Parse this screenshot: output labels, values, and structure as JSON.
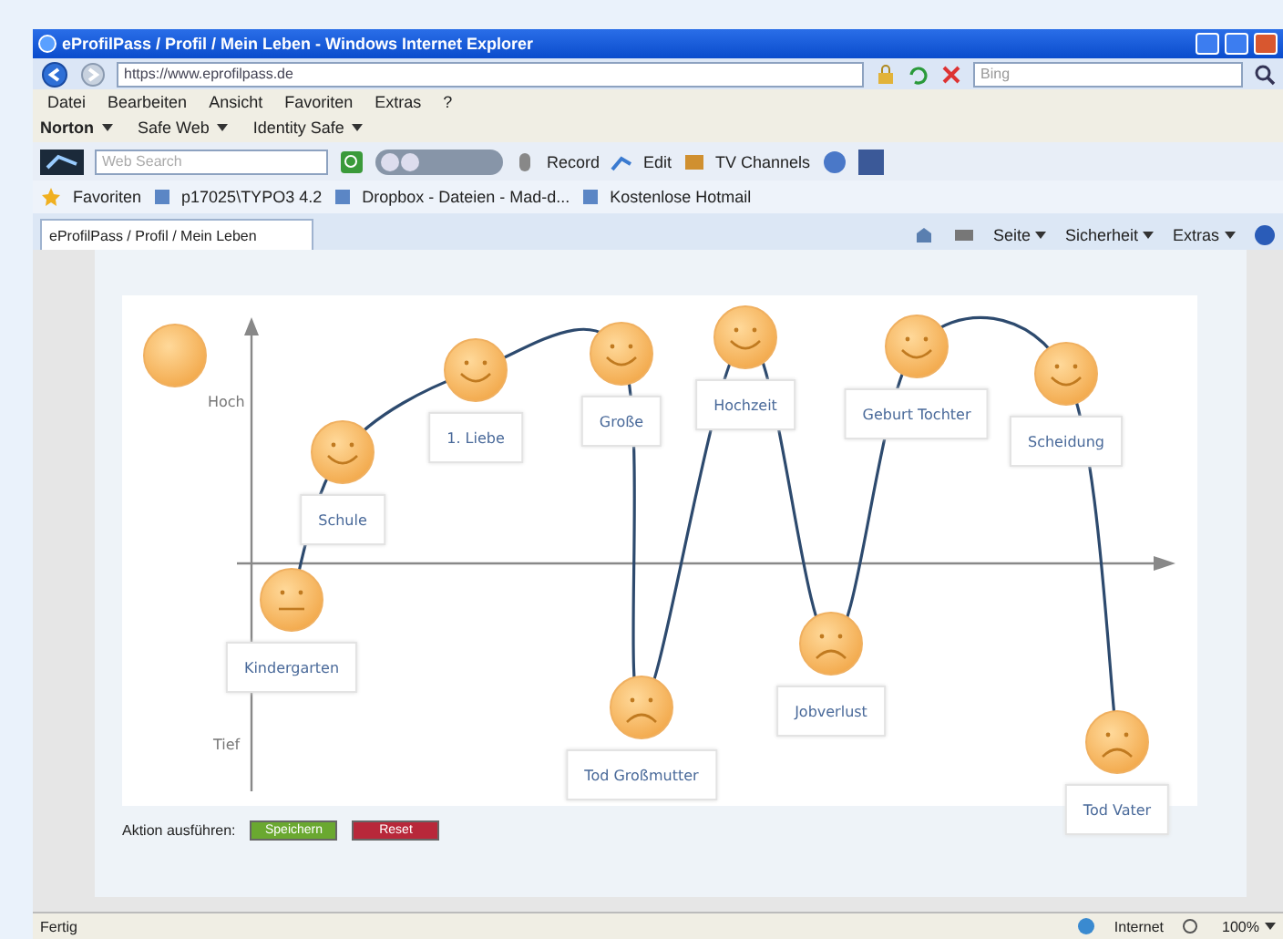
{
  "window": {
    "title": "eProfilPass / Profil / Mein Leben - Windows Internet Explorer"
  },
  "address_bar": {
    "url": "https://www.eprofilpass.de",
    "search_placeholder": "Bing"
  },
  "menu": [
    "Datei",
    "Bearbeiten",
    "Ansicht",
    "Favoriten",
    "Extras",
    "?"
  ],
  "norton_bar": [
    "Norton",
    "Safe Web",
    "Identity Safe"
  ],
  "toolbar": {
    "search_placeholder": "Web Search",
    "buttons": [
      "Record",
      "Edit",
      "TV Channels"
    ]
  },
  "favorites_bar": {
    "label": "Favoriten",
    "links": [
      "p17025\\TYPO3 4.2",
      "Dropbox - Dateien - Mad-d...",
      "Kostenlose Hotmail"
    ]
  },
  "tabs": [
    {
      "label": "eProfilPass / Profil / Mein Leben",
      "selected": true
    }
  ],
  "command_bar": [
    "Seite",
    "Sicherheit",
    "Extras"
  ],
  "chart": {
    "y_axis_top": "Hoch",
    "y_axis_bottom": "Tief",
    "events": [
      {
        "label": "Kindergarten",
        "kind": "neutral"
      },
      {
        "label": "Schule",
        "kind": "happy"
      },
      {
        "label": "1. Liebe",
        "kind": "happy"
      },
      {
        "label": "Große",
        "kind": "happy"
      },
      {
        "label": "Tod Großmutter",
        "kind": "sad"
      },
      {
        "label": "Hochzeit",
        "kind": "happy"
      },
      {
        "label": "Jobverlust",
        "kind": "sad"
      },
      {
        "label": "Geburt Tochter",
        "kind": "happy"
      },
      {
        "label": "Scheidung",
        "kind": "happy"
      },
      {
        "label": "Tod Vater",
        "kind": "sad"
      }
    ]
  },
  "actions": {
    "label": "Aktion ausführen:",
    "buttons": [
      {
        "label": "Speichern",
        "kind": "save"
      },
      {
        "label": "Reset",
        "kind": "reset"
      }
    ]
  },
  "status_bar": {
    "status": "Fertig",
    "zone": "Internet",
    "zoom": "100%"
  }
}
